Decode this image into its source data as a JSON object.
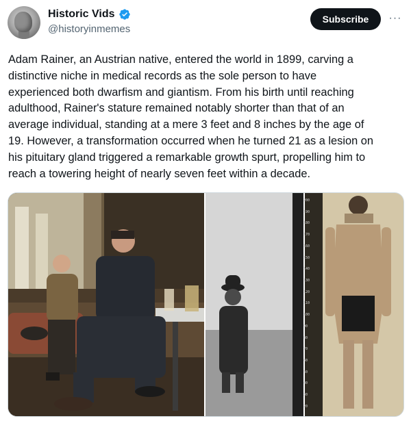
{
  "account": {
    "name": "Historic Vids",
    "handle": "@historyinmemes",
    "verified_color": "#1d9bf0"
  },
  "actions": {
    "subscribe_label": "Subscribe",
    "more_label": "···"
  },
  "post": {
    "text": "Adam Rainer, an Austrian native, entered the world in 1899, carving a\ndistinctive niche in medical records as the sole person to have\nexperienced both dwarfism and giantism. From his birth until reaching\nadulthood, Rainer's stature remained notably shorter than that of an\naverage individual, standing at a mere 3 feet and 8 inches by the age of\n19. However, a transformation occurred when he turned 21 as a lesion on\nhis pituitary gland triggered a remarkable growth spurt, propelling him to\nreach a towering height of nearly seven feet within a decade."
  },
  "media": {
    "ruler_ticks": [
      "200",
      "190",
      "180",
      "170",
      "160",
      "150",
      "140",
      "130",
      "120",
      "110",
      "100",
      "90",
      "80",
      "70",
      "60",
      "50",
      "40",
      "30",
      "20"
    ]
  }
}
